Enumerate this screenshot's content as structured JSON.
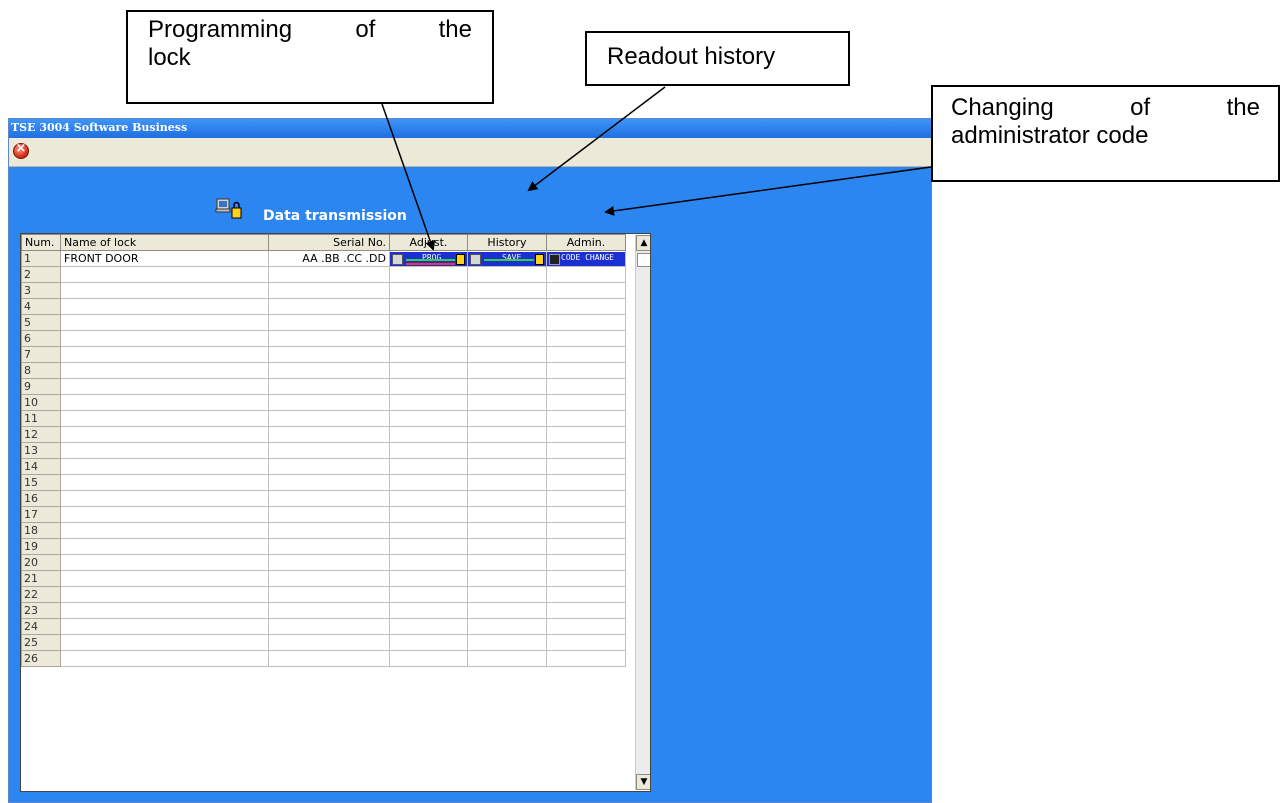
{
  "window": {
    "title": "TSE 3004 Software Business"
  },
  "panel": {
    "title": "Data transmission"
  },
  "table": {
    "headers": [
      "Num.",
      "Name of lock",
      "Serial No.",
      "Adjust.",
      "History",
      "Admin."
    ],
    "row1": {
      "num": "1",
      "name": "FRONT DOOR",
      "serial": "AA .BB .CC .DD",
      "adjust_label": "PROG",
      "history_label": "SAVE",
      "admin_label": "CODE CHANGE"
    },
    "row_numbers": [
      "2",
      "3",
      "4",
      "5",
      "6",
      "7",
      "8",
      "9",
      "10",
      "11",
      "12",
      "13",
      "14",
      "15",
      "16",
      "17",
      "18",
      "19",
      "20",
      "21",
      "22",
      "23",
      "24",
      "25",
      "26"
    ]
  },
  "annotations": {
    "programming": {
      "line1_words": [
        "Programming",
        "of",
        "the"
      ],
      "line2": "lock"
    },
    "history": {
      "text": "Readout history"
    },
    "admin": {
      "line1_words": [
        "Changing",
        "of",
        "the"
      ],
      "line2": "administrator code"
    }
  },
  "colors": {
    "window_bg": "#2b86f2",
    "titlebar": "#1f6fe0",
    "button_bar": "#1c2fd2"
  },
  "icons": [
    "close-icon",
    "computer-lock-icon",
    "scroll-up-icon",
    "scroll-down-icon"
  ]
}
